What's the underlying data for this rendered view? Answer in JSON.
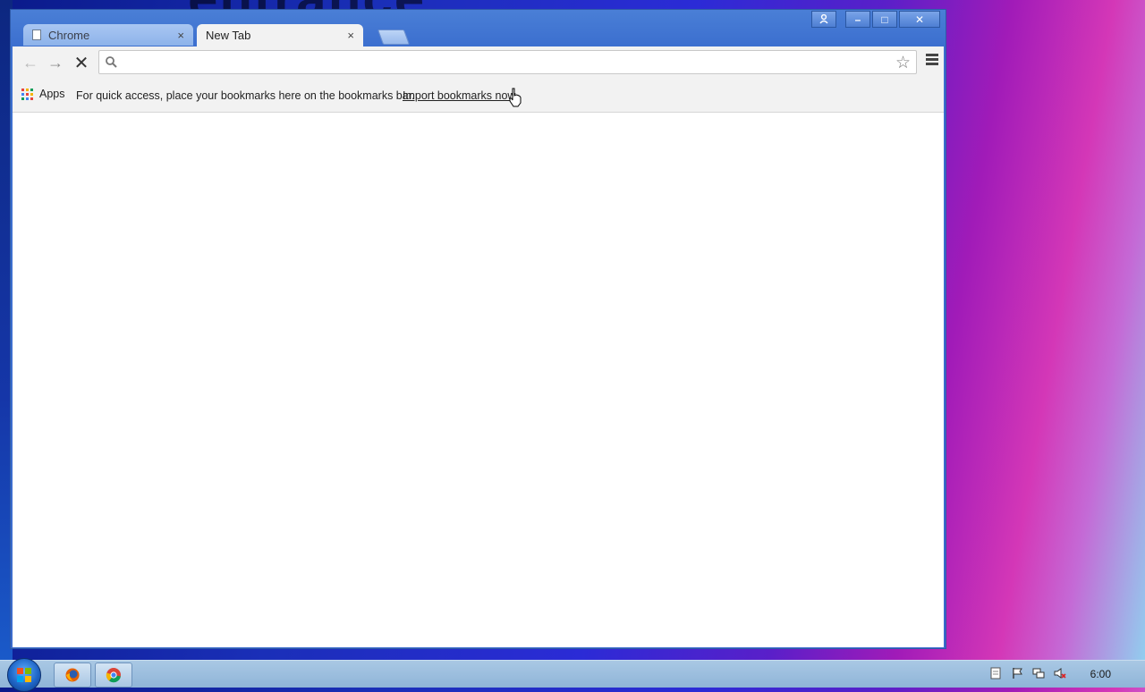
{
  "desktop": {
    "background_text": "entrance"
  },
  "window": {
    "tabs": [
      {
        "label": "Chrome",
        "close": "×"
      },
      {
        "label": "New Tab",
        "close": "×"
      }
    ],
    "controls": {
      "profile": "profile-icon",
      "minimize": "–",
      "maximize": "□",
      "close": "✕"
    }
  },
  "toolbar": {
    "back_icon": "←",
    "forward_icon": "→",
    "stop_icon": "✕",
    "omnibox": {
      "value": "",
      "placeholder": ""
    },
    "star_icon": "☆"
  },
  "bookmarks_bar": {
    "apps_label": "Apps",
    "message": "For quick access, place your bookmarks here on the bookmarks bar.",
    "import_link": "Import bookmarks now"
  },
  "taskbar": {
    "apps": [
      "firefox-icon",
      "chrome-icon"
    ],
    "clock": "6:00"
  },
  "colors": {
    "window_frame": "#3c6fcf",
    "tab_active": "#f2f2f2",
    "tab_inactive": "#a9c6f2"
  }
}
